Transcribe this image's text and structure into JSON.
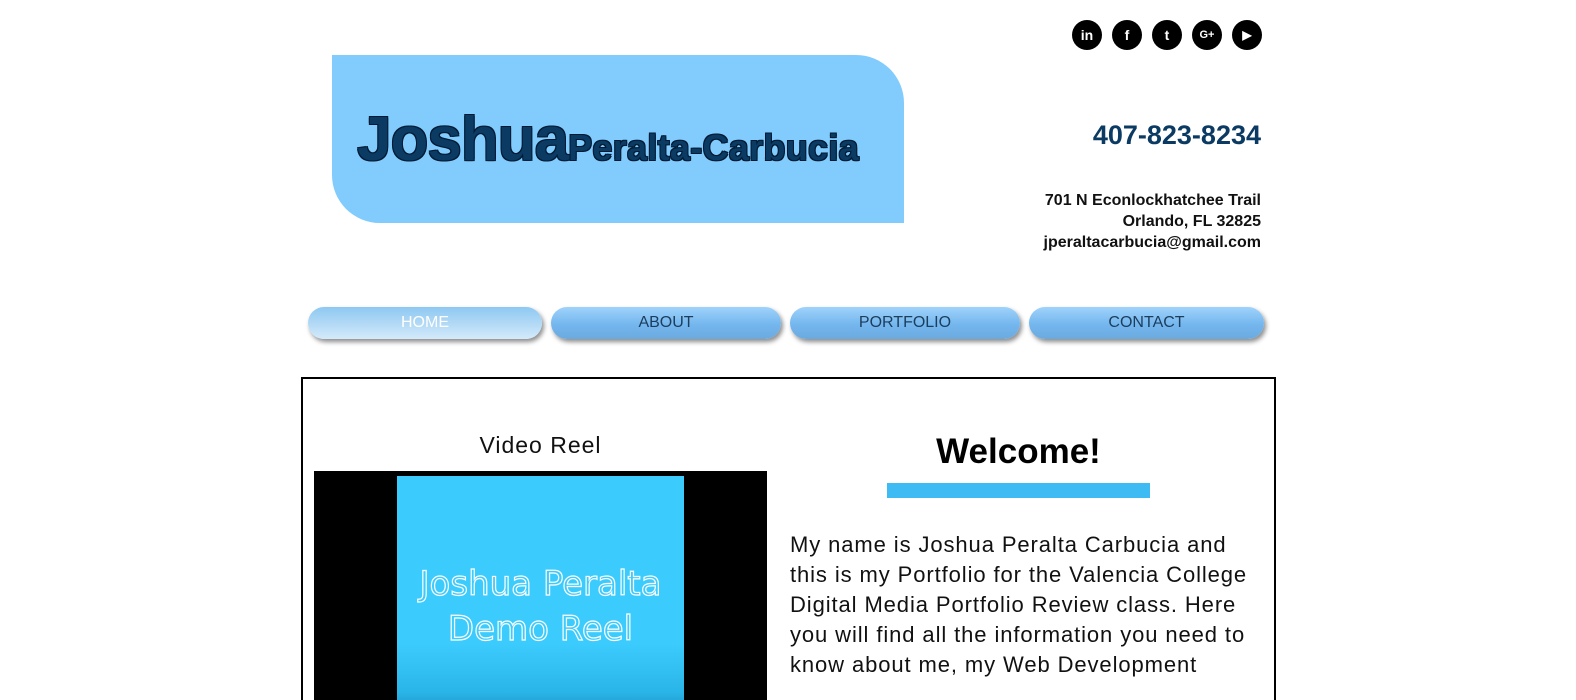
{
  "social": [
    {
      "icon": "linkedin-icon",
      "glyph": "in"
    },
    {
      "icon": "facebook-icon",
      "glyph": "f"
    },
    {
      "icon": "twitter-icon",
      "glyph": "t"
    },
    {
      "icon": "google-plus-icon",
      "glyph": "G+"
    },
    {
      "icon": "youtube-icon",
      "glyph": "▶"
    }
  ],
  "header": {
    "first_name": "Joshua",
    "last_name": "Peralta-Carbucia",
    "phone": "407-823-8234",
    "address_line1": "701 N Econlockhatchee Trail",
    "address_line2": "Orlando, FL 32825",
    "email": "jperaltacarbucia@gmail.com"
  },
  "nav": {
    "items": [
      {
        "label": "HOME",
        "active": true
      },
      {
        "label": "ABOUT",
        "active": false
      },
      {
        "label": "PORTFOLIO",
        "active": false
      },
      {
        "label": "CONTACT",
        "active": false
      }
    ]
  },
  "main": {
    "video_title": "Video Reel",
    "video_thumb_text": "Joshua Peralta\nDemo Reel",
    "welcome": "Welcome!",
    "intro": "My name is Joshua Peralta Carbucia and this is my Portfolio for the Valencia College Digital Media Portfolio Review class. Here you will find all the information you need to know about me, my Web Development"
  },
  "colors": {
    "banner": "#82cbfd",
    "name_text": "#0b3a63",
    "accent_bar": "#3fbbf4",
    "video_thumb": "#3ccbfd"
  }
}
